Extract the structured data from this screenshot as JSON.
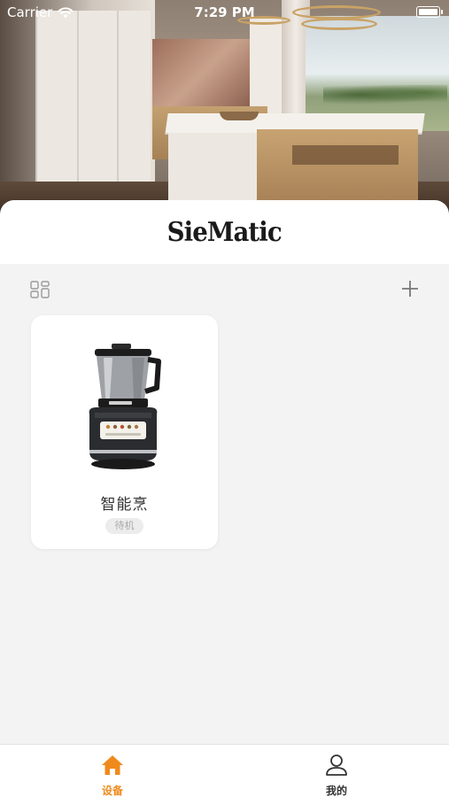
{
  "status_bar": {
    "carrier": "Carrier",
    "time": "7:29 PM"
  },
  "brand": {
    "name": "SieMatic"
  },
  "device": {
    "name": "智能烹",
    "status": "待机"
  },
  "tabs": [
    {
      "label": "设备",
      "icon": "home-icon",
      "active": true
    },
    {
      "label": "我的",
      "icon": "user-icon",
      "active": false
    }
  ],
  "colors": {
    "accent": "#f08a1c",
    "background": "#f3f3f3",
    "tab_inactive": "#333333"
  }
}
